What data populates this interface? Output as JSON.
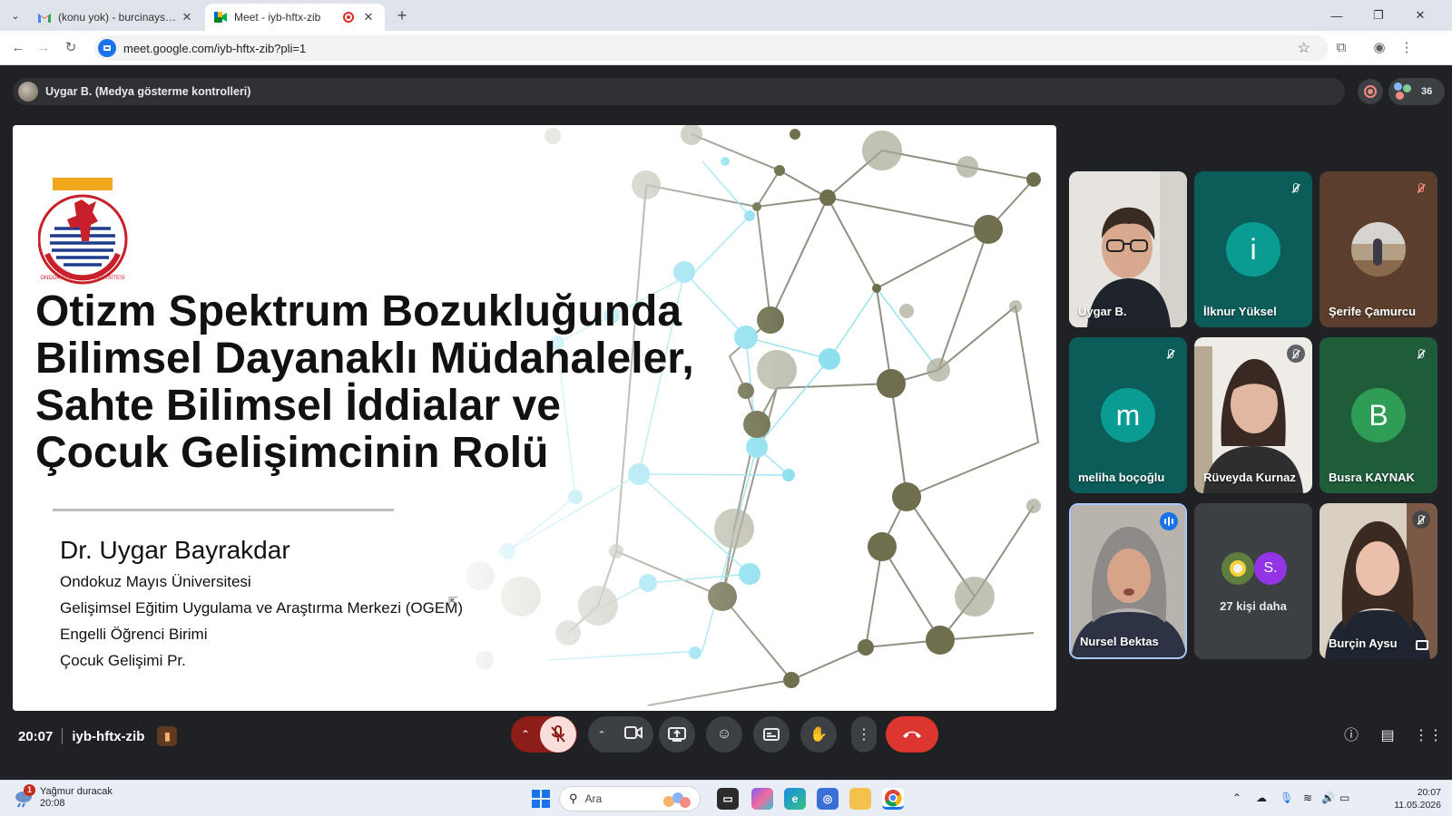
{
  "browser": {
    "tabs": [
      {
        "title": "(konu yok) - burcinaysuuu@gm",
        "icon": "gmail-icon",
        "active": false
      },
      {
        "title": "Meet - iyb-hftx-zib",
        "icon": "meet-icon",
        "active": true,
        "recording": true
      }
    ],
    "url": "meet.google.com/iyb-hftx-zib?pli=1"
  },
  "meet": {
    "presenter_label": "Uygar B. (Medya gösterme kontrolleri)",
    "participant_count": "36",
    "slide": {
      "title_lines": [
        "Otizm Spektrum Bozukluğunda",
        "Bilimsel Dayanaklı Müdahaleler,",
        "Sahte Bilimsel İddialar ve",
        "Çocuk Gelişimcinin Rolü"
      ],
      "author": "Dr. Uygar Bayrakdar",
      "affiliations": [
        "Ondokuz Mayıs Üniversitesi",
        "Gelişimsel Eğitim Uygulama ve Araştırma Merkezi (OGEM)",
        "Engelli Öğrenci Birimi",
        "Çocuk Gelişimi Pr."
      ],
      "logo_ring_text": "ONDOKUZ MAYIS ÜNİVERSİTESİ"
    },
    "participants": [
      {
        "name": "Uygar B.",
        "kind": "video",
        "muted": false
      },
      {
        "name": "İlknur Yüksel",
        "kind": "letter",
        "letter": "i",
        "muted": true
      },
      {
        "name": "Şerife Çamurcu",
        "kind": "photo",
        "muted": true
      },
      {
        "name": "meliha boçoğlu",
        "kind": "letter",
        "letter": "m",
        "muted": true
      },
      {
        "name": "Rüveyda Kurnaz",
        "kind": "video",
        "muted": true
      },
      {
        "name": "Busra KAYNAK",
        "kind": "letter",
        "letter": "B",
        "muted": true
      },
      {
        "name": "Nursel Bektas",
        "kind": "video",
        "speaking": true
      },
      {
        "name": "27 kişi daha",
        "kind": "more",
        "letter": "S."
      },
      {
        "name": "Burçin Aysu",
        "kind": "video",
        "muted": true
      }
    ],
    "time": "20:07",
    "meeting_code": "iyb-hftx-zib"
  },
  "taskbar": {
    "weather_title": "Yağmur duracak",
    "weather_time": "20:08",
    "weather_badge": "1",
    "search_placeholder": "Ara",
    "clock_time": "20:07",
    "clock_date": "11.05.2026"
  },
  "colors": {
    "meet_bg": "#202124",
    "tile_teal": "#0b5d5a",
    "tile_green": "#1e5c3a",
    "end_call": "#dc362e",
    "mic_off_bg": "#8c1d18"
  }
}
